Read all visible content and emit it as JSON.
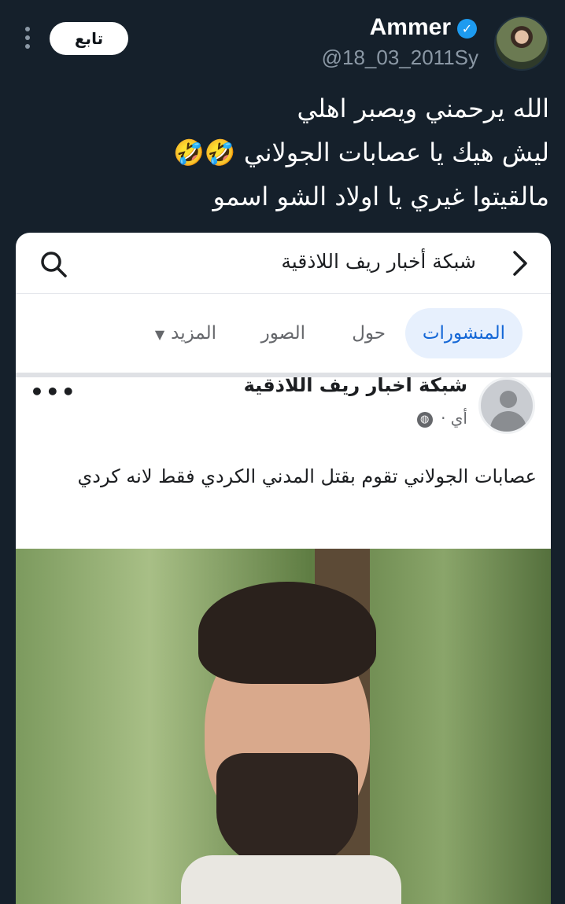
{
  "tweet": {
    "display_name": "Ammer",
    "handle": "@18_03_2011Sy",
    "follow_label": "تابع",
    "lines": [
      "الله يرحمني ويصبر اهلي",
      "ليش هيك يا عصابات الجولاني 🤣🤣",
      "مالقيتوا غيري يا اولاد الشو اسمو"
    ],
    "icons": {
      "verified": "verified-badge-icon",
      "more": "more-vertical-icon"
    }
  },
  "embedded": {
    "page_name": "شبكة أخبار ريف اللاذقية",
    "tabs": [
      {
        "label": "المنشورات",
        "active": true
      },
      {
        "label": "حول"
      },
      {
        "label": "الصور"
      },
      {
        "label": "المزيد"
      }
    ],
    "post": {
      "author": "شبكة اخبار ريف اللاذقية",
      "meta": "أي ·",
      "text": "عصابات الجولاني تقوم بقتل المدني الكردي فقط لانه كردي"
    },
    "colors": {
      "active_tab_bg": "#e7f0fd",
      "active_tab_text": "#1467d6"
    }
  },
  "colors": {
    "background": "#15202b",
    "accent": "#1d9bf0",
    "secondary_text": "#8b98a5"
  }
}
